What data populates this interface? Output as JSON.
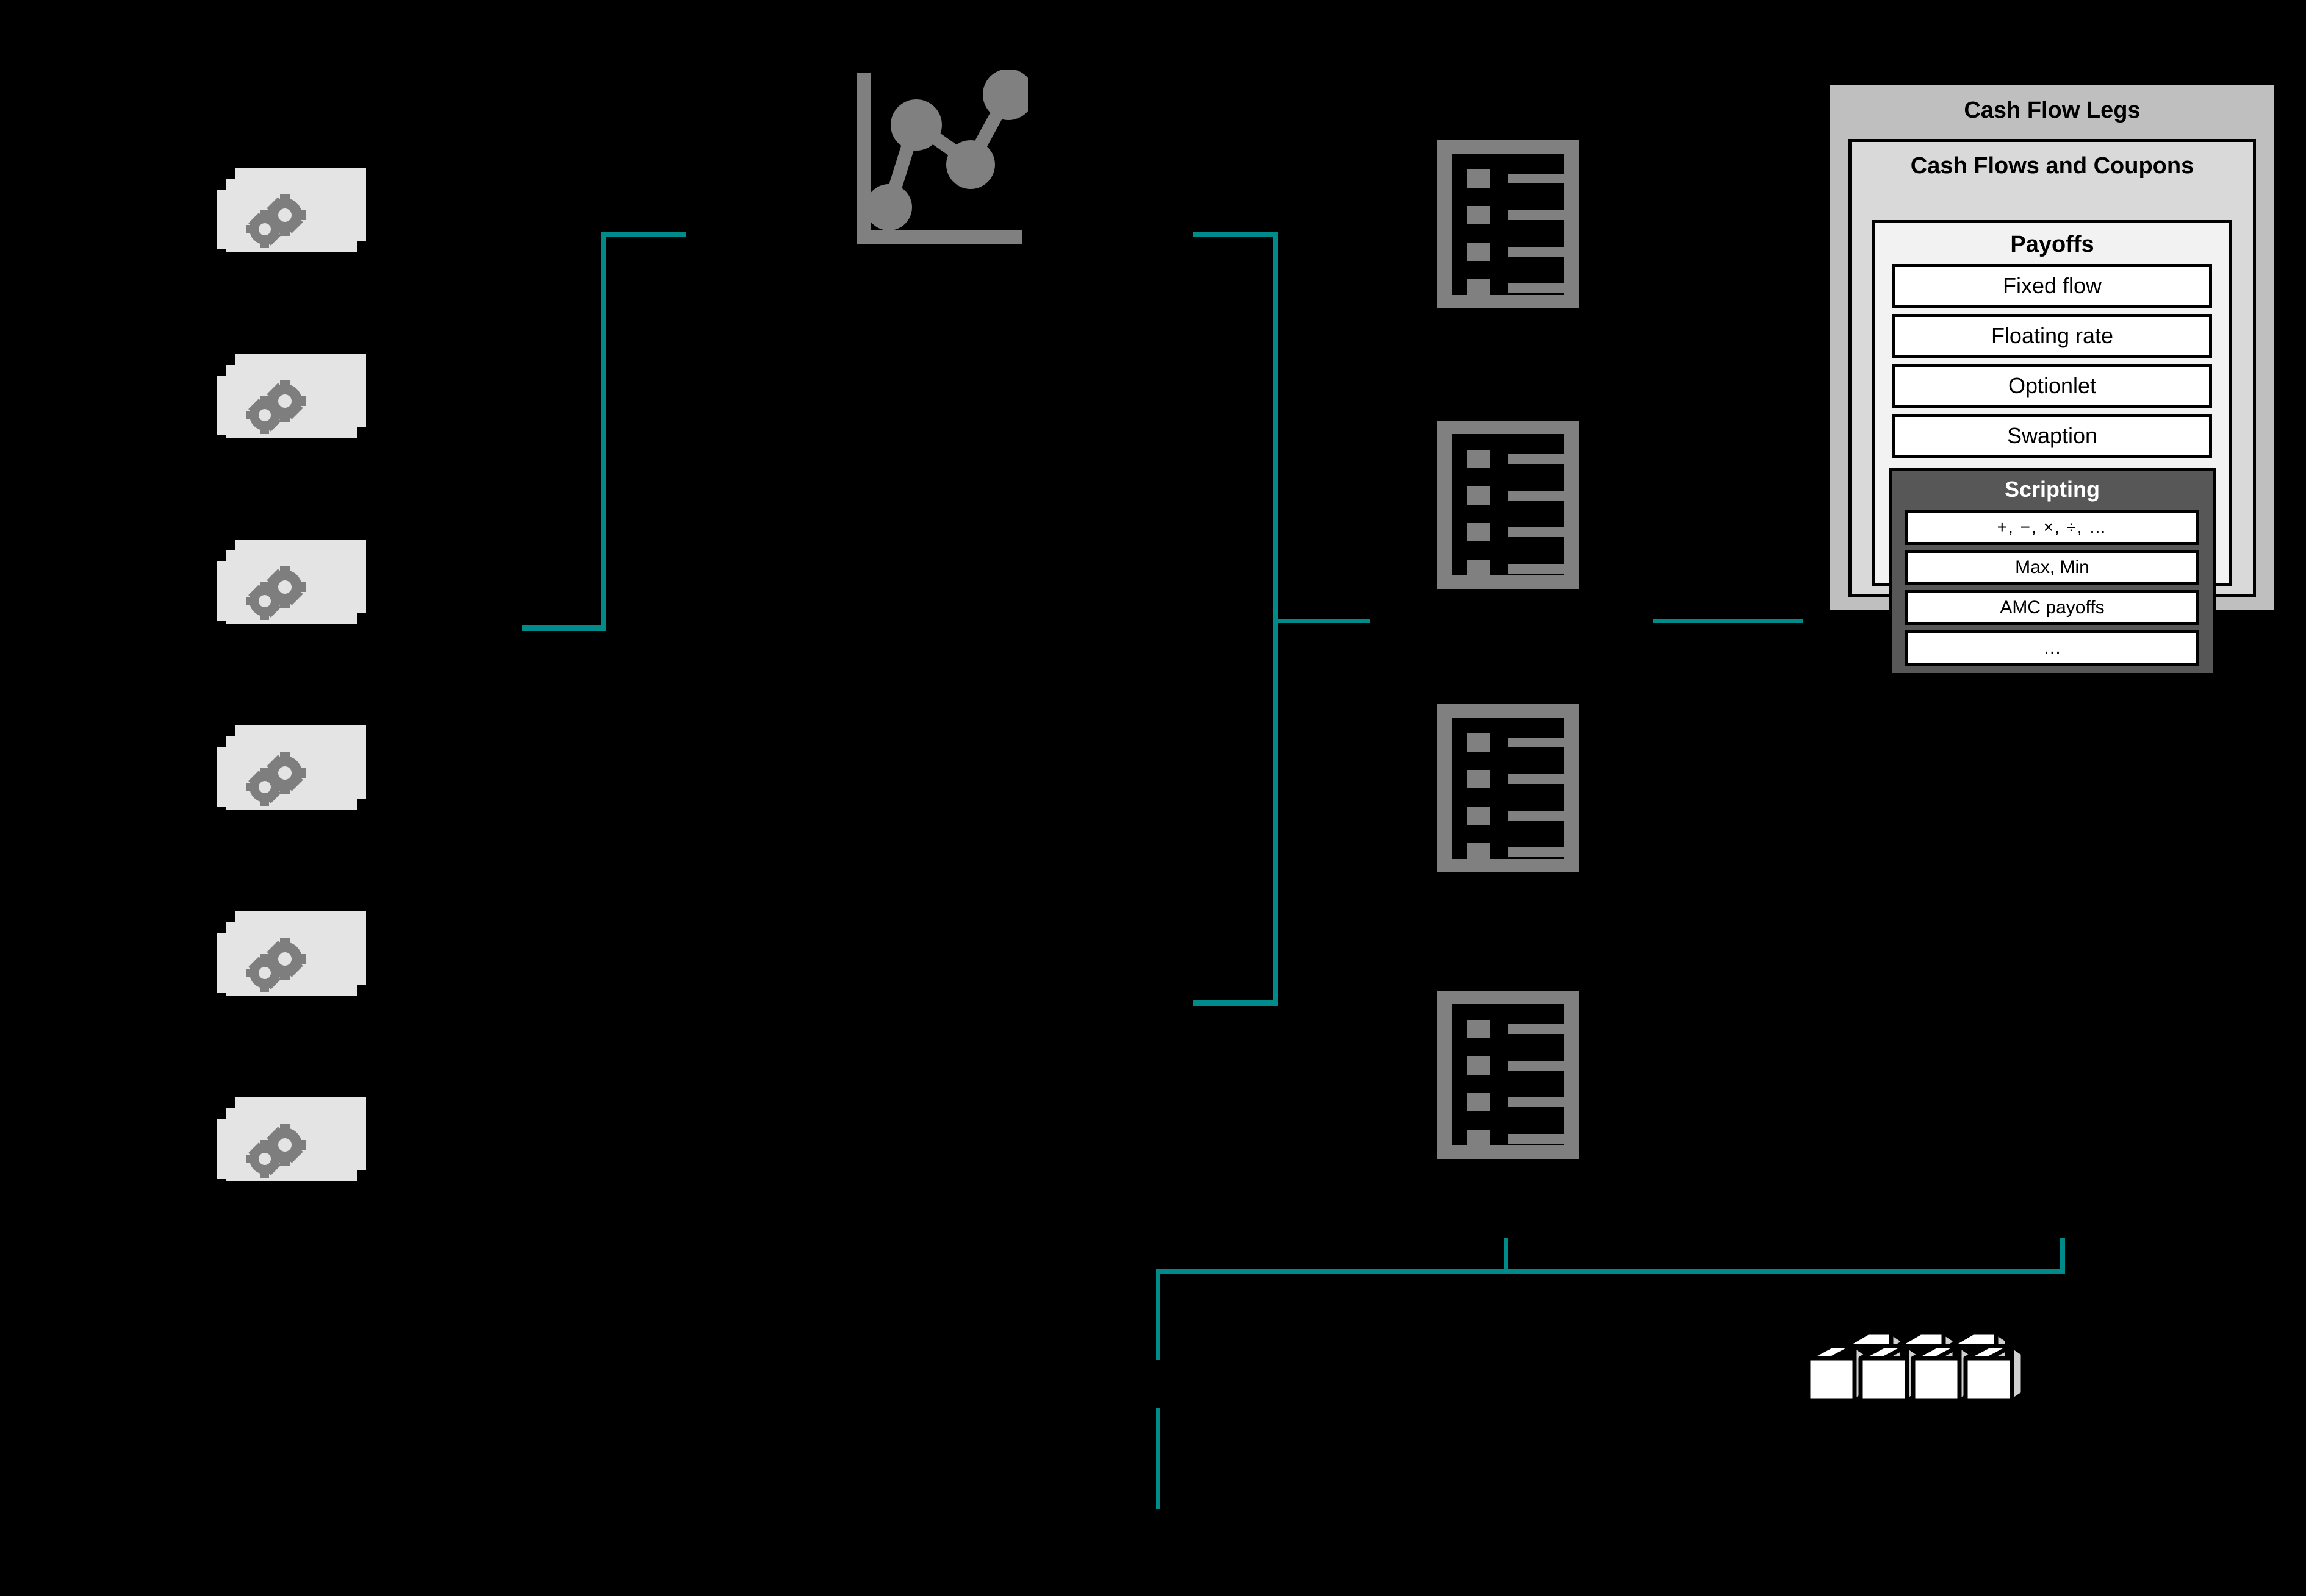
{
  "theme": {
    "background": "#000000",
    "connector_color": "#008b8b",
    "icon_gray": "#808080",
    "money_paper": "#e4e4e4",
    "panel_outer_bg": "#bfbfbf",
    "panel_mid_bg": "#d9d9d9",
    "panel_payoffs_bg": "#f2f2f2",
    "panel_scripting_bg": "#575757",
    "box_bg": "#ffffff",
    "cube_face": "#ffffff",
    "cube_side": "#d0d0d0"
  },
  "icons": {
    "money": "money-gears-icon",
    "chart": "line-chart-icon",
    "document": "list-document-icon",
    "cubes": "cube-stack-icon"
  },
  "columns": {
    "money_count": 6,
    "document_count": 4,
    "cube_count": 4
  },
  "panel": {
    "outer_title": "Cash Flow Legs",
    "mid_title": "Cash Flows and Coupons",
    "payoffs": {
      "title": "Payoffs",
      "items": [
        {
          "label": "Fixed flow"
        },
        {
          "label": "Floating rate"
        },
        {
          "label": "Optionlet"
        },
        {
          "label": "Swaption"
        }
      ]
    },
    "scripting": {
      "title": "Scripting",
      "items": [
        {
          "label": "+, −, ×, ÷, …"
        },
        {
          "label": "Max, Min"
        },
        {
          "label": "AMC payoffs"
        },
        {
          "label": "…"
        }
      ]
    }
  }
}
